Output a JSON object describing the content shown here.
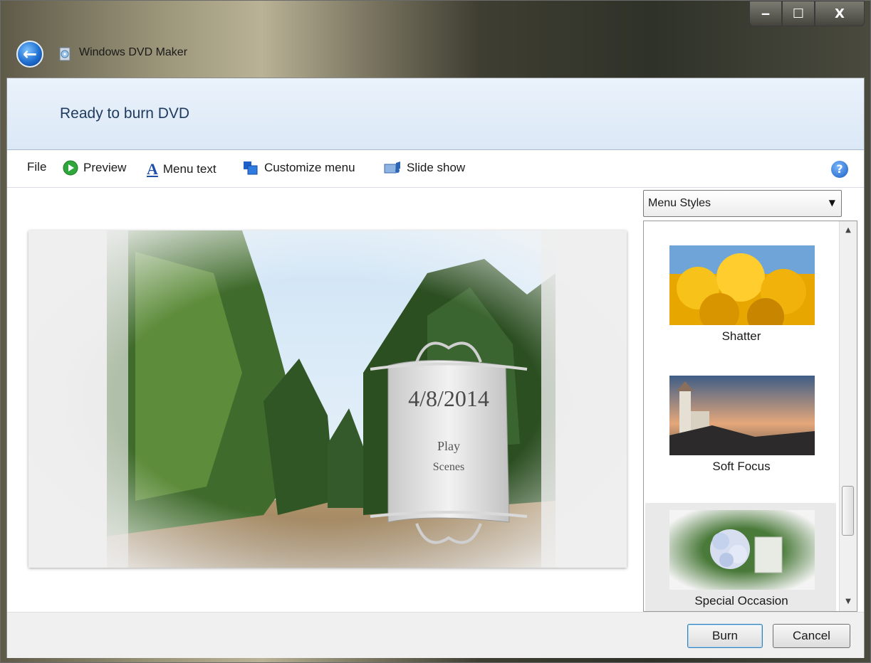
{
  "window": {
    "title": "Windows DVD Maker",
    "controls": {
      "minimize": "‒",
      "maximize": "☐",
      "close": "X"
    }
  },
  "header": {
    "title": "Ready to burn DVD"
  },
  "toolbar": {
    "file": "File",
    "preview": "Preview",
    "menu_text": "Menu text",
    "customize_menu": "Customize menu",
    "slide_show": "Slide show",
    "help": "?"
  },
  "preview": {
    "date": "4/8/2014",
    "play": "Play",
    "scenes": "Scenes"
  },
  "menu_styles": {
    "selected_value": "Menu Styles",
    "items": [
      {
        "label": "Shatter",
        "selected": false
      },
      {
        "label": "Soft Focus",
        "selected": false
      },
      {
        "label": "Special Occasion",
        "selected": true
      }
    ]
  },
  "buttons": {
    "burn": "Burn",
    "cancel": "Cancel"
  },
  "colors": {
    "header_bg": "#dbe8f6",
    "title_text": "#1f3a5e",
    "accent_blue": "#1f6fd1"
  }
}
